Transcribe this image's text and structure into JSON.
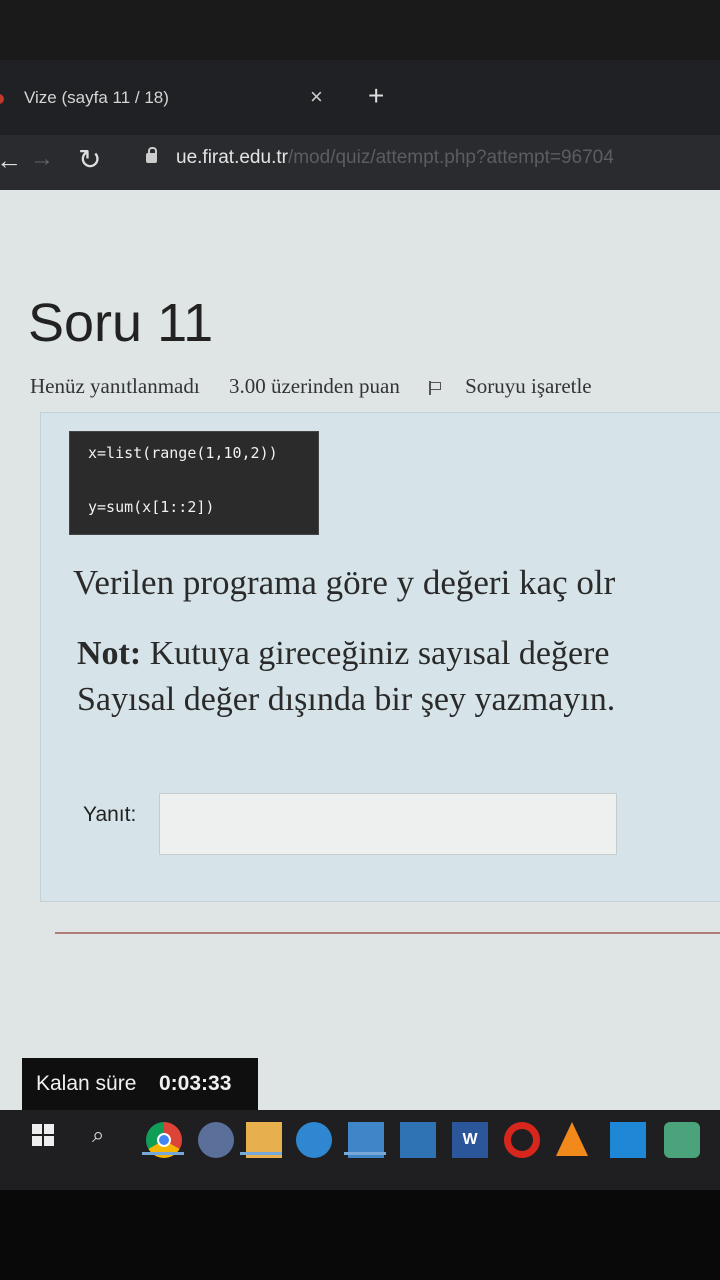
{
  "browser": {
    "tab_title": "Vize (sayfa 11 / 18)",
    "close_tab": "×",
    "new_tab": "+",
    "url_host": "ue.firat.edu.tr",
    "url_path": "/mod/quiz/attempt.php?attempt=96704"
  },
  "question": {
    "title": "Soru 11",
    "status": "Henüz yanıtlanmadı",
    "points": "3.00 üzerinden puan",
    "flag_label": "Soruyu işaretle",
    "code_line1": "x=list(range(1,10,2))",
    "code_line2": "y=sum(x[1::2])",
    "text": "Verilen programa göre y değeri kaç olr",
    "note_prefix": "Not:",
    "note_line1": "Kutuya gireceğiniz sayısal değere",
    "note_line2": "Sayısal değer dışında bir şey yazmayın.",
    "answer_label": "Yanıt:",
    "answer_value": ""
  },
  "timer": {
    "label": "Kalan süre",
    "value": "0:03:33"
  },
  "taskbar": {
    "icons": [
      "windows-start-icon",
      "search-icon",
      "chrome-icon",
      "app-icon",
      "file-explorer-icon",
      "edge-icon",
      "mail-icon",
      "photos-icon",
      "word-icon",
      "opera-icon",
      "vlc-icon",
      "vscode-icon",
      "app-icon"
    ]
  }
}
